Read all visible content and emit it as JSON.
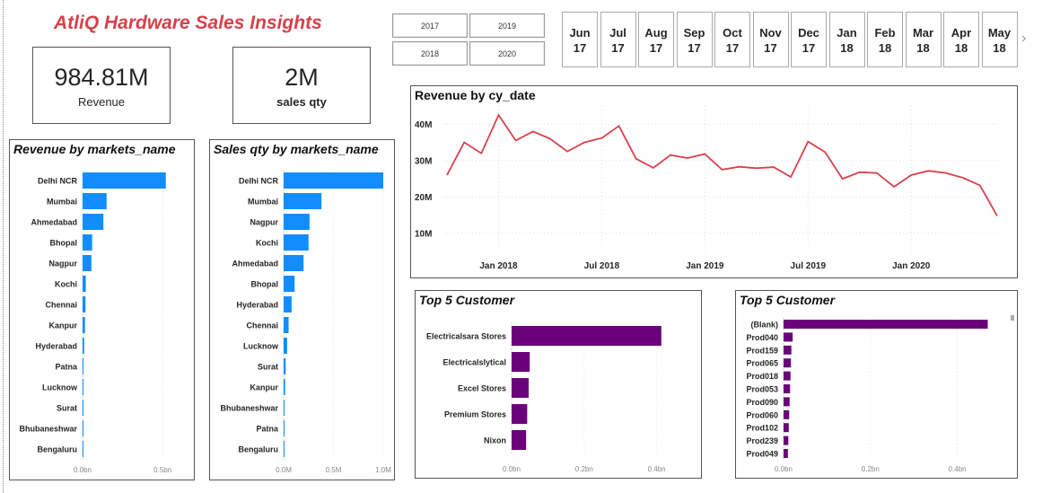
{
  "header": {
    "title": "AtliQ Hardware Sales Insights"
  },
  "kpis": [
    {
      "value": "984.81M",
      "label": "Revenue"
    },
    {
      "value": "2M",
      "label": "sales qty"
    }
  ],
  "year_slicer": [
    "2017",
    "2019",
    "2018",
    "2020"
  ],
  "month_slicer": [
    {
      "m": "Jun",
      "y": "17"
    },
    {
      "m": "Jul",
      "y": "17"
    },
    {
      "m": "Aug",
      "y": "17"
    },
    {
      "m": "Sep",
      "y": "17"
    },
    {
      "m": "Oct",
      "y": "17"
    },
    {
      "m": "Nov",
      "y": "17"
    },
    {
      "m": "Dec",
      "y": "17"
    },
    {
      "m": "Jan",
      "y": "18"
    },
    {
      "m": "Feb",
      "y": "18"
    },
    {
      "m": "Mar",
      "y": "18"
    },
    {
      "m": "Apr",
      "y": "18"
    },
    {
      "m": "May",
      "y": "18"
    }
  ],
  "colors": {
    "blue": "#118dff",
    "purple": "#6b007b",
    "red": "#d7414a"
  },
  "chart_data": [
    {
      "id": "rev_market",
      "type": "bar",
      "orientation": "horizontal",
      "title": "Revenue by markets_name",
      "categories": [
        "Delhi NCR",
        "Mumbai",
        "Ahmedabad",
        "Bhopal",
        "Nagpur",
        "Kochi",
        "Chennai",
        "Kanpur",
        "Hyderabad",
        "Patna",
        "Lucknow",
        "Surat",
        "Bhubaneshwar",
        "Bengaluru"
      ],
      "values": [
        0.52,
        0.15,
        0.13,
        0.06,
        0.055,
        0.02,
        0.018,
        0.015,
        0.01,
        0.004,
        0.003,
        0.002,
        0.001,
        0.0005
      ],
      "unit": "bn",
      "xlim": [
        0,
        0.6
      ],
      "ticks": [
        {
          "v": 0,
          "label": "0.0bn"
        },
        {
          "v": 0.5,
          "label": "0.5bn"
        }
      ]
    },
    {
      "id": "qty_market",
      "type": "bar",
      "orientation": "horizontal",
      "title": "Sales qty by markets_name",
      "categories": [
        "Delhi NCR",
        "Mumbai",
        "Nagpur",
        "Kochi",
        "Ahmedabad",
        "Bhopal",
        "Hyderabad",
        "Chennai",
        "Lucknow",
        "Surat",
        "Kanpur",
        "Bhubaneshwar",
        "Patna",
        "Bengaluru"
      ],
      "values": [
        1.0,
        0.38,
        0.26,
        0.25,
        0.2,
        0.11,
        0.08,
        0.05,
        0.035,
        0.02,
        0.015,
        0.008,
        0.003,
        0.001
      ],
      "unit": "M",
      "xlim": [
        0,
        1.0
      ],
      "ticks": [
        {
          "v": 0,
          "label": "0.0M"
        },
        {
          "v": 0.5,
          "label": "0.5M"
        },
        {
          "v": 1.0,
          "label": "1.0M"
        }
      ]
    },
    {
      "id": "rev_date",
      "type": "line",
      "title": "Revenue by cy_date",
      "x_labels": [
        {
          "i": 3,
          "label": "Jan 2018"
        },
        {
          "i": 9,
          "label": "Jul 2018"
        },
        {
          "i": 15,
          "label": "Jan 2019"
        },
        {
          "i": 21,
          "label": "Jul 2019"
        },
        {
          "i": 27,
          "label": "Jan 2020"
        }
      ],
      "y_ticks": [
        {
          "v": 10,
          "label": "10M"
        },
        {
          "v": 20,
          "label": "20M"
        },
        {
          "v": 30,
          "label": "30M"
        },
        {
          "v": 40,
          "label": "40M"
        }
      ],
      "ylim": [
        8,
        45
      ],
      "values": [
        26,
        35,
        32,
        42.5,
        35.5,
        38,
        36,
        32.5,
        35,
        36.2,
        39.5,
        30.5,
        28,
        31.5,
        30.7,
        31.8,
        27.5,
        28.3,
        27.9,
        28.2,
        25.5,
        35.2,
        32.3,
        25,
        26.8,
        26.6,
        22.8,
        26,
        27.2,
        26.6,
        25.3,
        23.2,
        14.8
      ]
    },
    {
      "id": "top_cust",
      "type": "bar",
      "orientation": "horizontal",
      "title": "Top 5 Customer",
      "categories": [
        "Electricalsara Stores",
        "Electricalslytical",
        "Excel Stores",
        "Premium Stores",
        "Nixon"
      ],
      "values": [
        0.413,
        0.05,
        0.047,
        0.043,
        0.04
      ],
      "unit": "bn",
      "xlim": [
        0,
        0.5
      ],
      "ticks": [
        {
          "v": 0,
          "label": "0.0bn"
        },
        {
          "v": 0.2,
          "label": "0.2bn"
        },
        {
          "v": 0.4,
          "label": "0.4bn"
        }
      ]
    },
    {
      "id": "top_prod",
      "type": "bar",
      "orientation": "horizontal",
      "title": "Top 5 Customer",
      "categories": [
        "(Blank)",
        "Prod040",
        "Prod159",
        "Prod065",
        "Prod018",
        "Prod053",
        "Prod090",
        "Prod060",
        "Prod102",
        "Prod239",
        "Prod049"
      ],
      "values": [
        0.47,
        0.021,
        0.018,
        0.017,
        0.016,
        0.015,
        0.014,
        0.013,
        0.012,
        0.011,
        0.01
      ],
      "unit": "bn",
      "xlim": [
        0,
        0.5
      ],
      "ticks": [
        {
          "v": 0,
          "label": "0.0bn"
        },
        {
          "v": 0.2,
          "label": "0.2bn"
        },
        {
          "v": 0.4,
          "label": "0.4bn"
        }
      ]
    }
  ]
}
